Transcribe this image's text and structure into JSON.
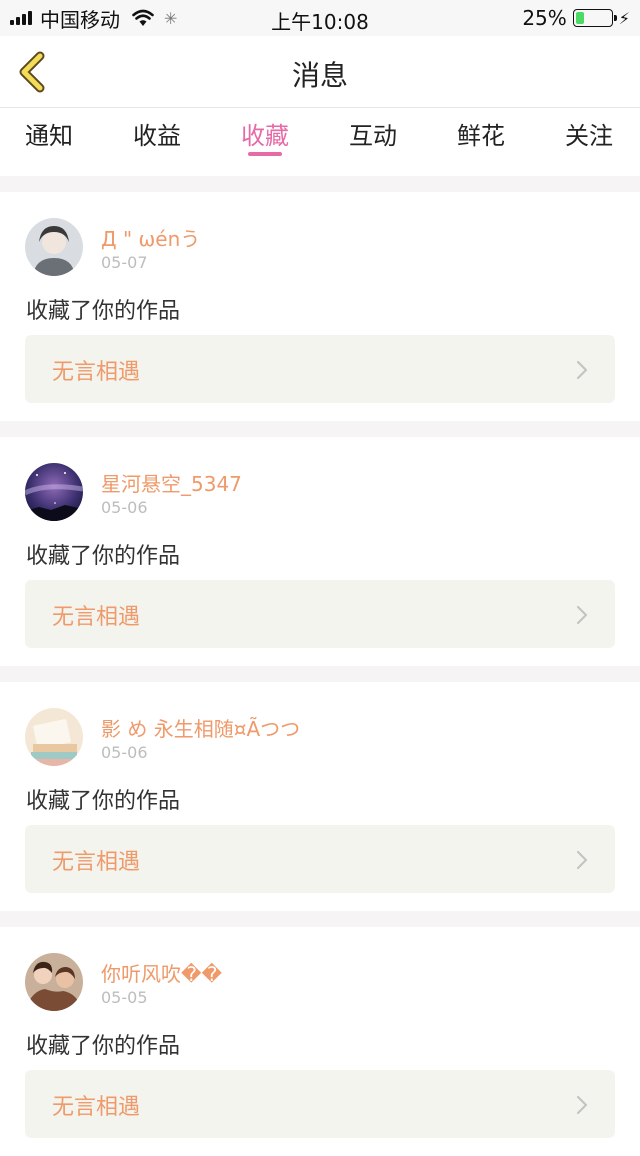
{
  "status_bar": {
    "carrier": "中国移动",
    "time": "上午10:08",
    "battery": "25%",
    "battery_level": 0.25
  },
  "nav": {
    "title": "消息"
  },
  "tabs": [
    {
      "label": "通知",
      "active": false
    },
    {
      "label": "收益",
      "active": false
    },
    {
      "label": "收藏",
      "active": true
    },
    {
      "label": "互动",
      "active": false
    },
    {
      "label": "鲜花",
      "active": false
    },
    {
      "label": "关注",
      "active": false
    }
  ],
  "feed": [
    {
      "username": "Д \" ωénう",
      "date": "05-07",
      "action": "收藏了你的作品",
      "work": "无言相遇",
      "avatar": "portrait"
    },
    {
      "username": "星河悬空_5347",
      "date": "05-06",
      "action": "收藏了你的作品",
      "work": "无言相遇",
      "avatar": "starry-sky"
    },
    {
      "username": "影 め 永生相随¤Ãつつ",
      "date": "05-06",
      "action": "收藏了你的作品",
      "work": "无言相遇",
      "avatar": "books"
    },
    {
      "username": "你听风吹��",
      "date": "05-05",
      "action": "收藏了你的作品",
      "work": "无言相遇",
      "avatar": "people-photo"
    }
  ],
  "colors": {
    "accent_pink": "#e76aa8",
    "username_orange": "#ef9a6a",
    "card_bg": "#f4f4ef"
  }
}
